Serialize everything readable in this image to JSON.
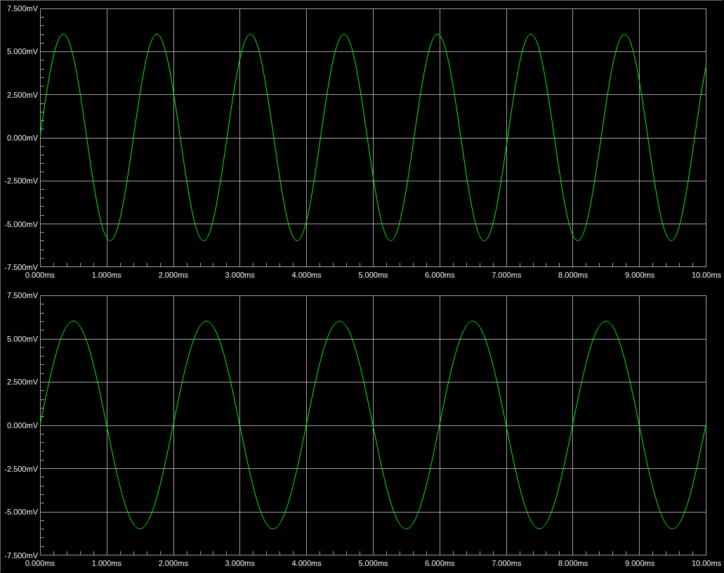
{
  "plots": [
    {
      "y_ticks": [
        "7.500mV",
        "5.000mV",
        "2.500mV",
        "0.000mV",
        "-2.500mV",
        "-5.000mV",
        "-7.500mV"
      ],
      "x_ticks": [
        "0.000ms",
        "1.000ms",
        "2.000ms",
        "3.000ms",
        "4.000ms",
        "5.000ms",
        "6.000ms",
        "7.000ms",
        "8.000ms",
        "9.000ms",
        "10.00ms"
      ]
    },
    {
      "y_ticks": [
        "7.500mV",
        "5.000mV",
        "2.500mV",
        "0.000mV",
        "-2.500mV",
        "-5.000mV",
        "-7.500mV"
      ],
      "x_ticks": [
        "0.000ms",
        "1.000ms",
        "2.000ms",
        "3.000ms",
        "4.000ms",
        "5.000ms",
        "6.000ms",
        "7.000ms",
        "8.000ms",
        "9.000ms",
        "10.00ms"
      ]
    }
  ]
}
